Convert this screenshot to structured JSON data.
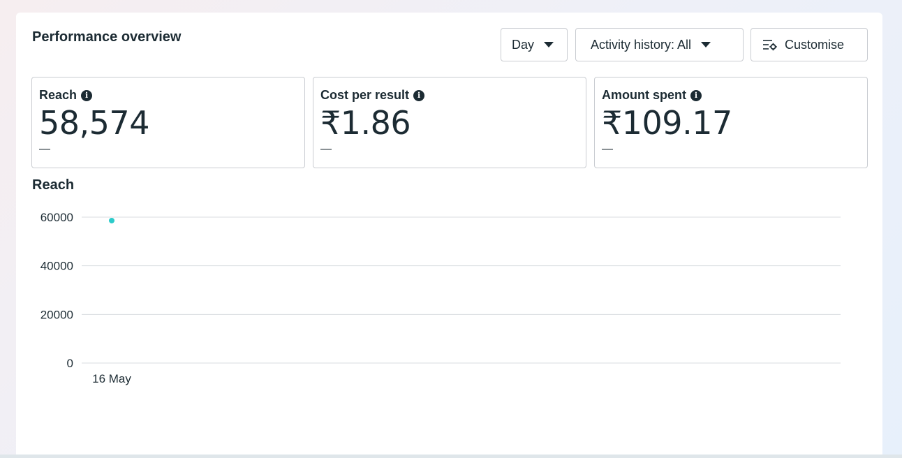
{
  "header": {
    "title": "Performance overview",
    "day_label": "Day",
    "activity_label": "Activity history: All",
    "customise_label": "Customise"
  },
  "metrics": [
    {
      "label": "Reach",
      "value": "58,574",
      "delta": "—"
    },
    {
      "label": "Cost per result",
      "value": "₹1.86",
      "delta": "—"
    },
    {
      "label": "Amount spent",
      "value": "₹109.17",
      "delta": "—"
    }
  ],
  "icons": {
    "info": "info-icon",
    "caret": "caret-down-icon",
    "customise": "sliders-gear-icon"
  },
  "colors": {
    "series": "#2ccbca",
    "gridline": "#dadde1",
    "text": "#1c2b33"
  },
  "chart_data": {
    "type": "line",
    "title": "Reach",
    "x": [
      "16 May"
    ],
    "series": [
      {
        "values": [
          58574
        ]
      }
    ],
    "y_ticks": [
      "0",
      "20000",
      "40000",
      "60000"
    ],
    "ylim": [
      0,
      60000
    ],
    "grid": true
  }
}
